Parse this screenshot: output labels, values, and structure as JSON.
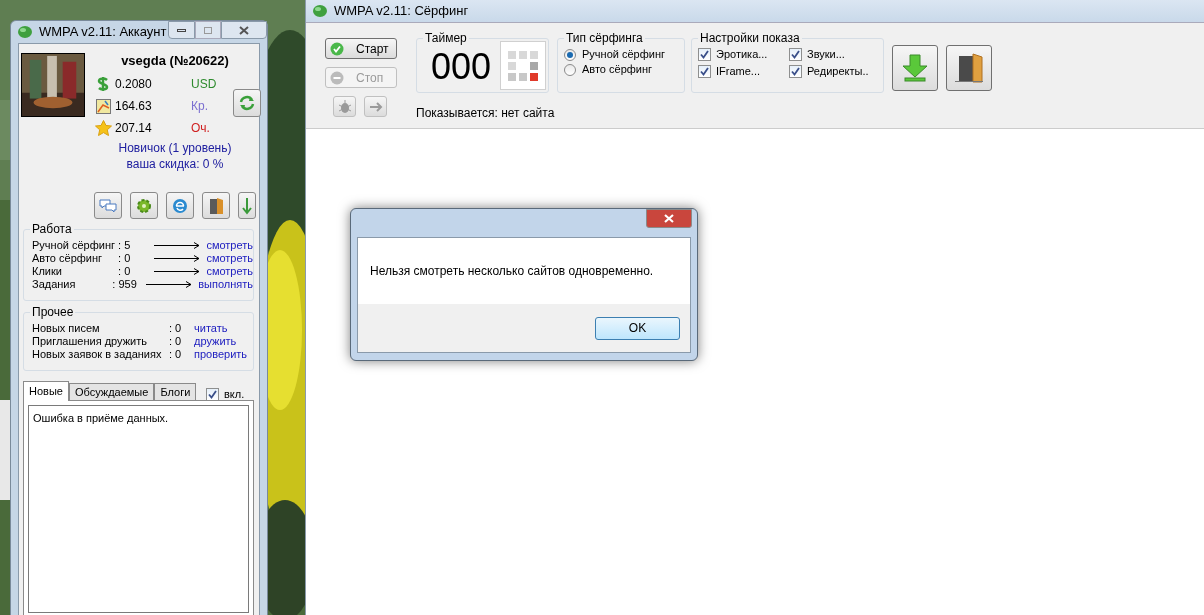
{
  "account_window": {
    "title": "WMPA v2.11: Аккаунт",
    "username": "vsegda (№20622)",
    "balances": [
      {
        "kind": "dollar",
        "value": "0.2080",
        "unit": "USD",
        "color": "#2e8b2e"
      },
      {
        "kind": "map",
        "value": "164.63",
        "unit": "Кр.",
        "color": "#7b6fd0"
      },
      {
        "kind": "star",
        "value": "207.14",
        "unit": "Оч.",
        "color": "#d02020"
      }
    ],
    "rank": "Новичок (1 уровень)",
    "discount": "ваша скидка: 0 %",
    "work": {
      "title": "Работа",
      "rows": [
        {
          "label": "Ручной сёрфинг",
          "value": ": 5",
          "link": "смотреть"
        },
        {
          "label": "Авто сёрфинг",
          "value": ": 0",
          "link": "смотреть"
        },
        {
          "label": "Клики",
          "value": ": 0",
          "link": "смотреть"
        },
        {
          "label": "Задания",
          "value": ": 959",
          "link": "выполнять"
        }
      ]
    },
    "other": {
      "title": "Прочее",
      "rows": [
        {
          "label": "Новых писем",
          "value": ": 0",
          "link": "читать"
        },
        {
          "label": "Приглашения дружить",
          "value": ": 0",
          "link": "дружить"
        },
        {
          "label": "Новых заявок в заданиях",
          "value": ": 0",
          "link": "проверить"
        }
      ]
    },
    "tabs": [
      {
        "label": "Новые",
        "selected": true
      },
      {
        "label": "Обсуждаемые",
        "selected": false
      },
      {
        "label": "Блоги",
        "selected": false
      }
    ],
    "enable_checkbox": {
      "label": "вкл.",
      "checked": true
    },
    "news_text": "Ошибка в приёме данных."
  },
  "surfing_window": {
    "title": "WMPA v2.11: Сёрфинг",
    "start_button": {
      "label": "Старт",
      "disabled": false
    },
    "stop_button": {
      "label": "Стоп",
      "disabled": true
    },
    "timer": {
      "title": "Таймер",
      "value": "000"
    },
    "surfing_type": {
      "title": "Тип сёрфинга",
      "options": [
        {
          "label": "Ручной сёрфинг",
          "selected": true
        },
        {
          "label": "Авто сёрфинг",
          "selected": false
        }
      ]
    },
    "display_settings": {
      "title": "Настройки показа",
      "options": [
        {
          "label": "Эротика...",
          "checked": true
        },
        {
          "label": "Звуки...",
          "checked": true
        },
        {
          "label": "IFrame...",
          "checked": true
        },
        {
          "label": "Редиректы..",
          "checked": true
        }
      ]
    },
    "status": "Показывается: нет сайта"
  },
  "dialog": {
    "message": "Нельзя смотреть несколько сайтов одновременно.",
    "button": "OK"
  }
}
